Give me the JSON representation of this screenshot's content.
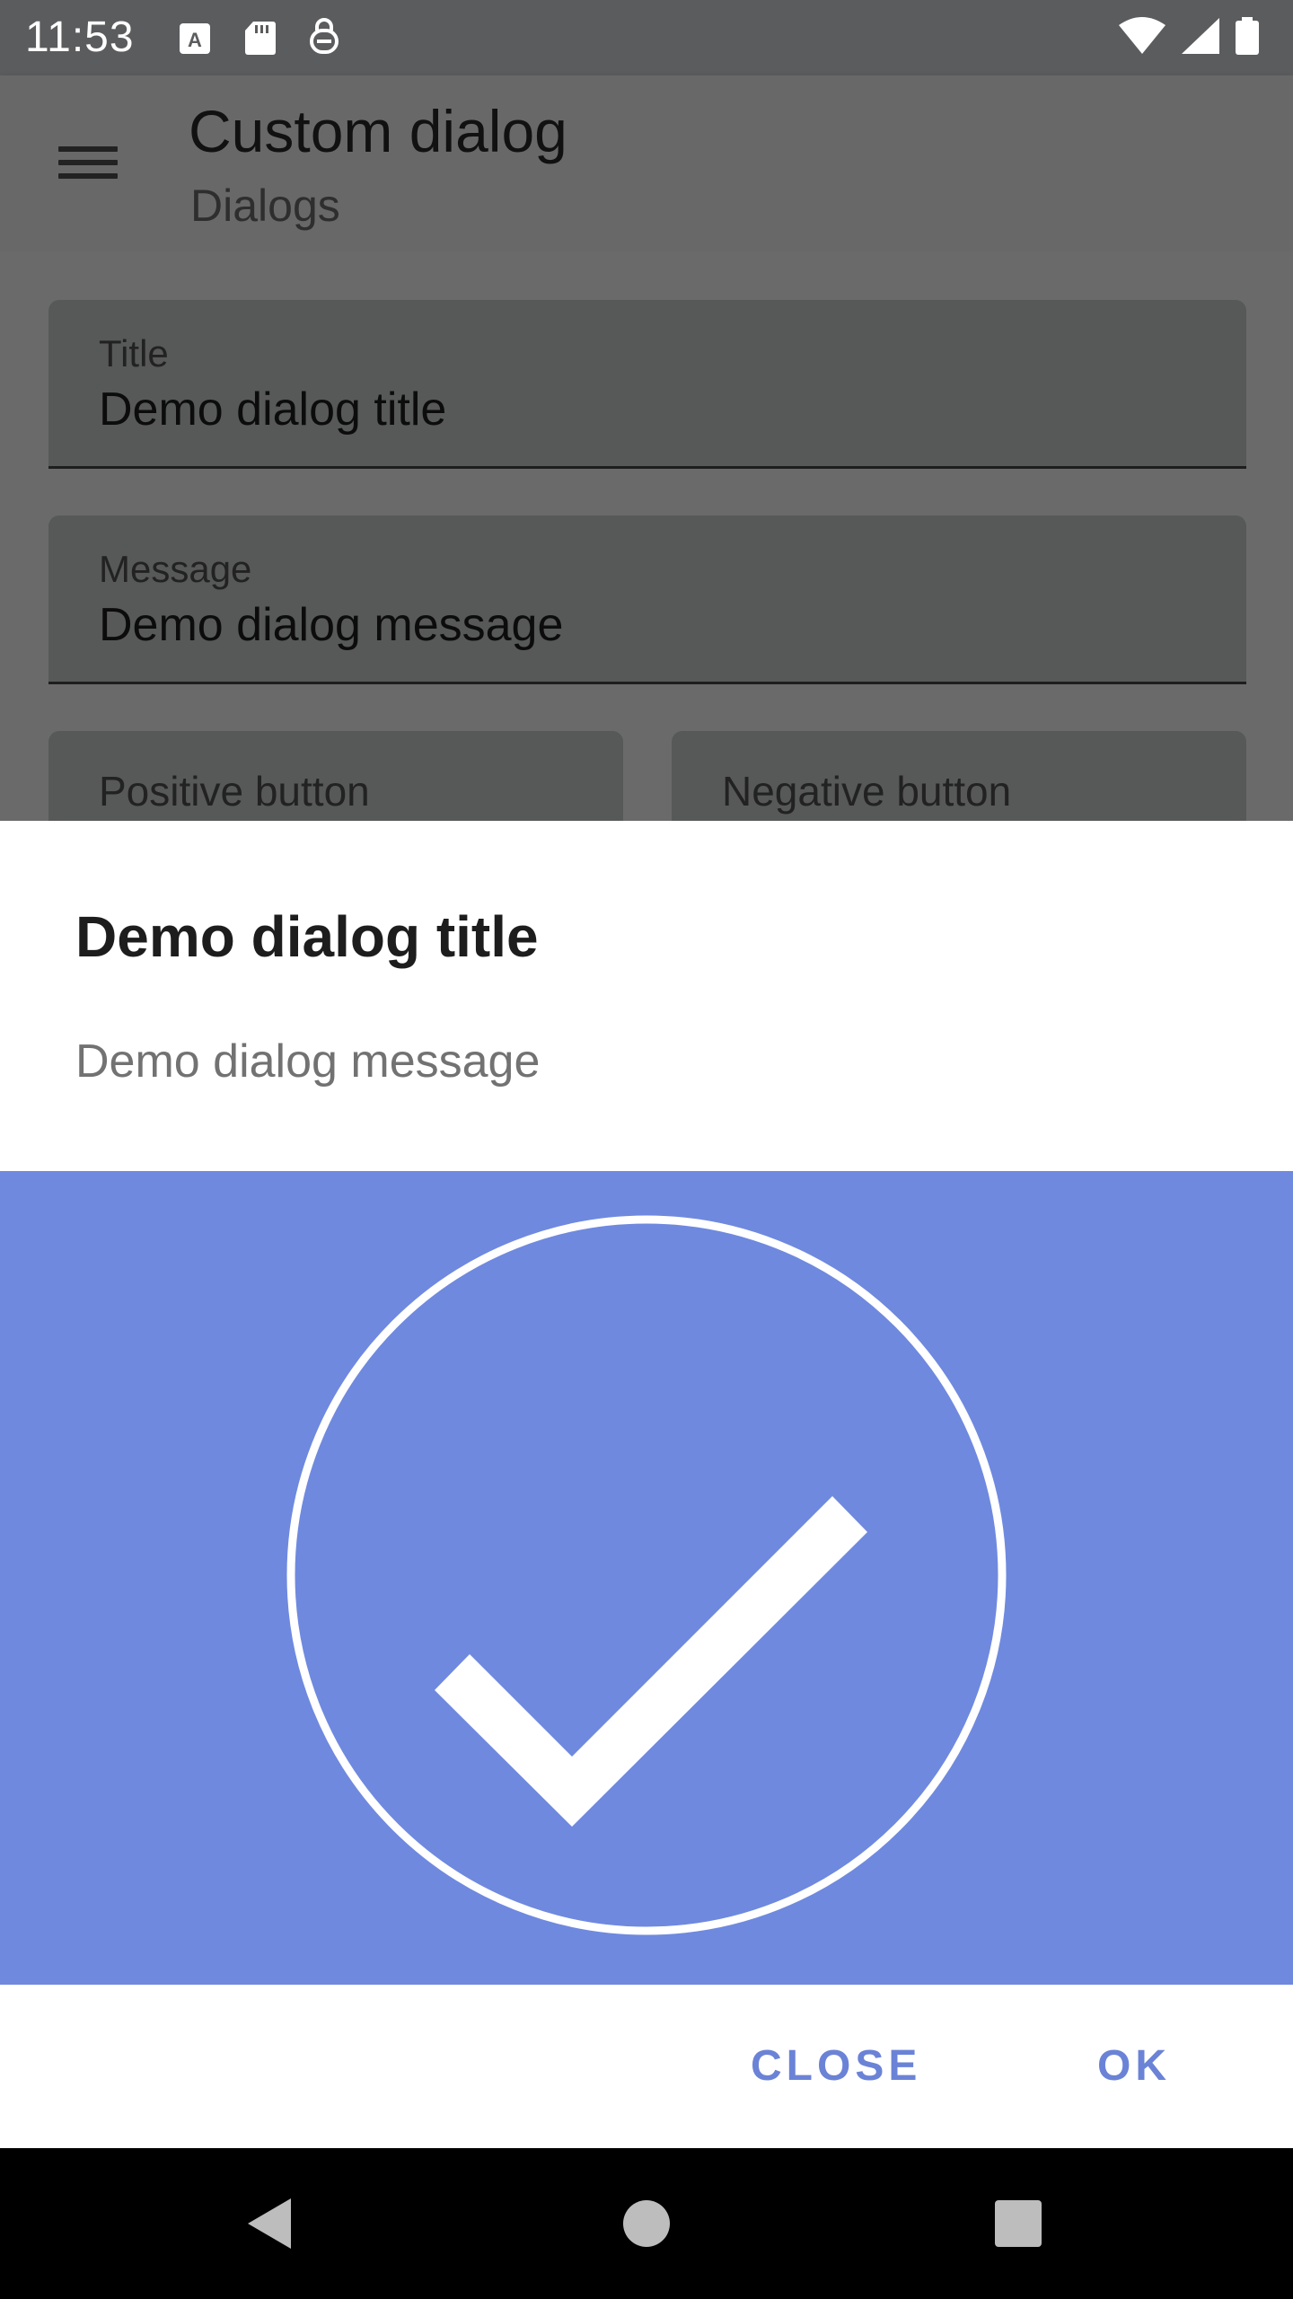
{
  "status_bar": {
    "time": "11:53",
    "icons_left": [
      "keyboard-a-icon",
      "sd-card-icon",
      "vpn-key-icon"
    ],
    "icons_right": [
      "wifi-icon",
      "cell-signal-icon",
      "battery-icon"
    ]
  },
  "app_bar": {
    "menu_icon": "hamburger-menu-icon",
    "title": "Custom dialog",
    "subtitle": "Dialogs"
  },
  "form": {
    "title_field": {
      "label": "Title",
      "value": "Demo dialog title"
    },
    "message_field": {
      "label": "Message",
      "value": "Demo dialog message"
    },
    "positive_field": {
      "label": "Positive button"
    },
    "negative_field": {
      "label": "Negative button"
    }
  },
  "dialog": {
    "title": "Demo dialog title",
    "message": "Demo dialog message",
    "image_icon": "check-circle-icon",
    "image_bg_color": "#6f89df",
    "close_label": "CLOSE",
    "ok_label": "OK",
    "accent_color": "#6b83d6"
  },
  "nav_bar": {
    "buttons": [
      "back-icon",
      "home-icon",
      "recents-icon"
    ]
  }
}
